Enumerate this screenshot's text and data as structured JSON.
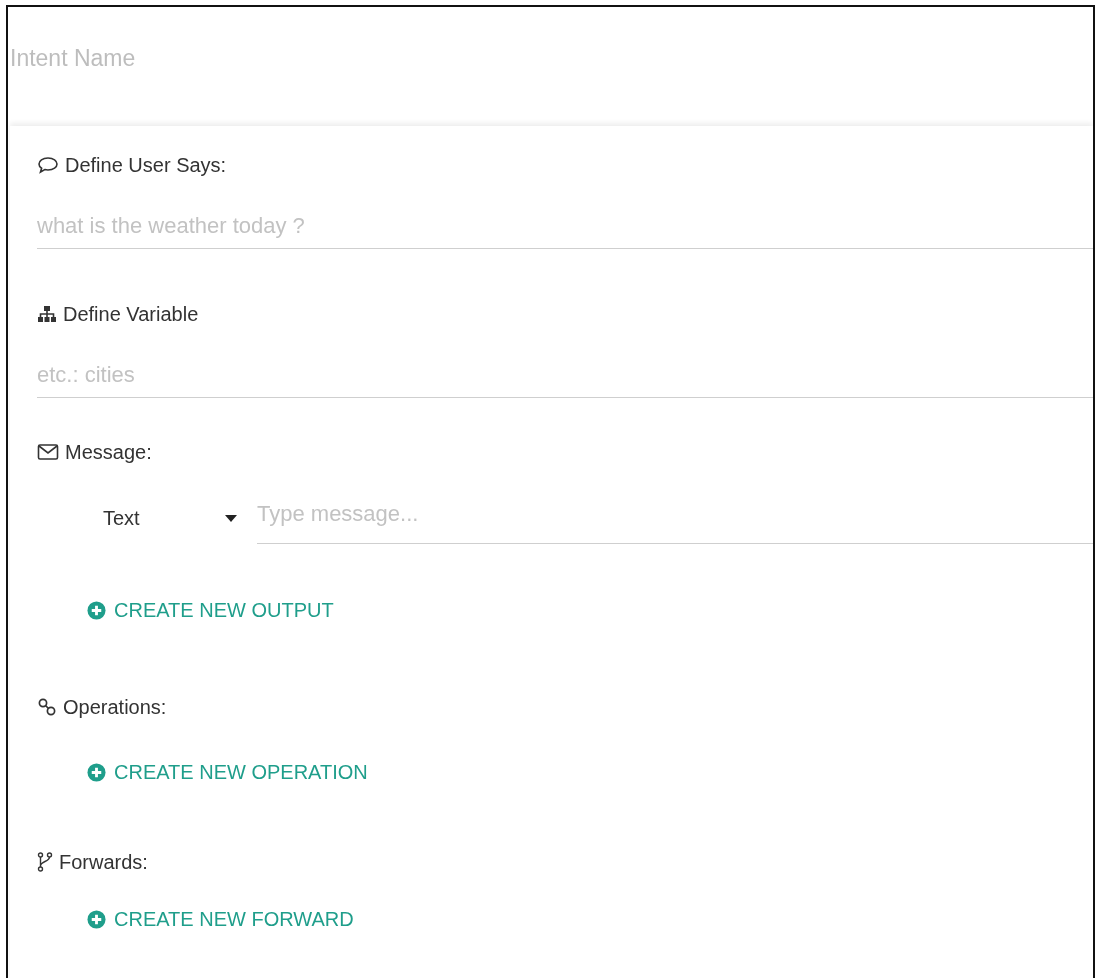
{
  "intent_name": {
    "placeholder": "Intent Name"
  },
  "sections": [
    {
      "kind": "field",
      "label": "Define User Says:",
      "placeholder": "what is the weather today ?"
    },
    {
      "kind": "field",
      "label": "Define Variable",
      "placeholder": "etc.: cities"
    },
    {
      "kind": "message",
      "label": "Message:",
      "select_value": "Text",
      "placeholder": "Type message...",
      "action": "CREATE NEW OUTPUT"
    },
    {
      "kind": "action",
      "label": "Operations:",
      "action": "CREATE NEW OPERATION"
    },
    {
      "kind": "action",
      "label": "Forwards:",
      "action": "CREATE NEW FORWARD"
    }
  ]
}
